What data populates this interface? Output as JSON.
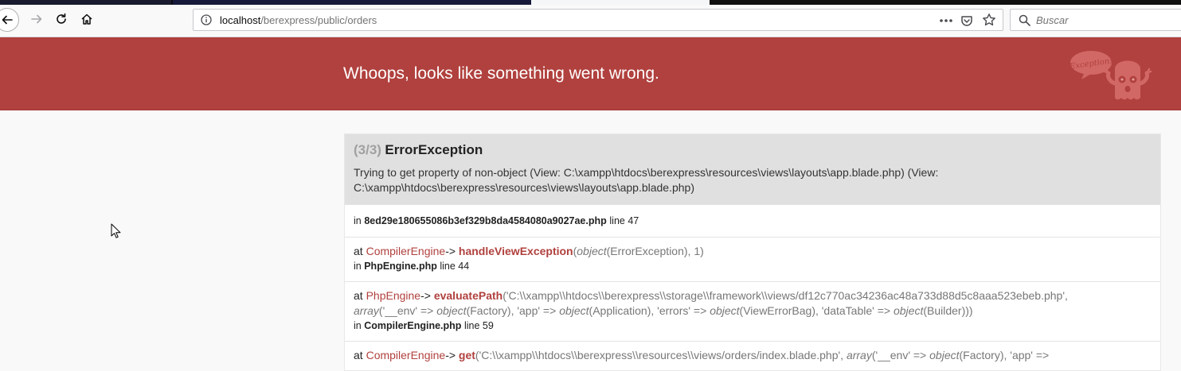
{
  "browser": {
    "url_host": "localhost",
    "url_path": "/berexpress/public/orders",
    "search_placeholder": "Buscar",
    "page_actions_label": "•••"
  },
  "header": {
    "title": "Whoops, looks like something went wrong.",
    "mascot_text": "Exception!"
  },
  "error": {
    "count": "(3/3)",
    "class_name": "ErrorException",
    "message": "Trying to get property of non-object (View: C:\\xampp\\htdocs\\berexpress\\resources\\views\\layouts\\app.blade.php) (View: C:\\xampp\\htdocs\\berexpress\\resources\\views\\layouts\\app.blade.php)"
  },
  "trace": [
    {
      "in_label": "in",
      "file": "8ed29e180655086b3ef329b8da4584080a9027ae.php",
      "line_label": "line 47"
    },
    {
      "at_label": "at",
      "class": "CompilerEngine",
      "arrow": "->",
      "method": "handleViewException",
      "args_open": "(",
      "args_kw": "object",
      "args_rest": "(ErrorException), 1)",
      "in_label": "in",
      "file": "PhpEngine.php",
      "line_label": "line 44"
    },
    {
      "at_label": "at",
      "class": "PhpEngine",
      "arrow": "->",
      "method": "evaluatePath",
      "args_line1": "('C:\\\\xampp\\\\htdocs\\\\berexpress\\\\storage\\\\framework\\\\views/df12c770ac34236ac48a733d88d5c8aaa523ebeb.php',",
      "args_line2_a": "array",
      "args_line2_b": "('__env' => ",
      "args_line2_c": "object",
      "args_line2_d": "(Factory), 'app' => ",
      "args_line2_e": "object",
      "args_line2_f": "(Application), 'errors' => ",
      "args_line2_g": "object",
      "args_line2_h": "(ViewErrorBag), 'dataTable' => ",
      "args_line2_i": "object",
      "args_line2_j": "(Builder)))",
      "in_label": "in",
      "file": "CompilerEngine.php",
      "line_label": "line 59"
    },
    {
      "at_label": "at",
      "class": "CompilerEngine",
      "arrow": "->",
      "method": "get",
      "args_a": "('C:\\\\xampp\\\\htdocs\\\\berexpress\\\\resources\\\\views/orders/index.blade.php', ",
      "args_b": "array",
      "args_c": "('__env' => ",
      "args_d": "object",
      "args_e": "(Factory), 'app' =>"
    }
  ],
  "colors": {
    "header_bg": "#b0413e",
    "accent": "#b0413e",
    "panel_head_bg": "#e0e0e0"
  }
}
